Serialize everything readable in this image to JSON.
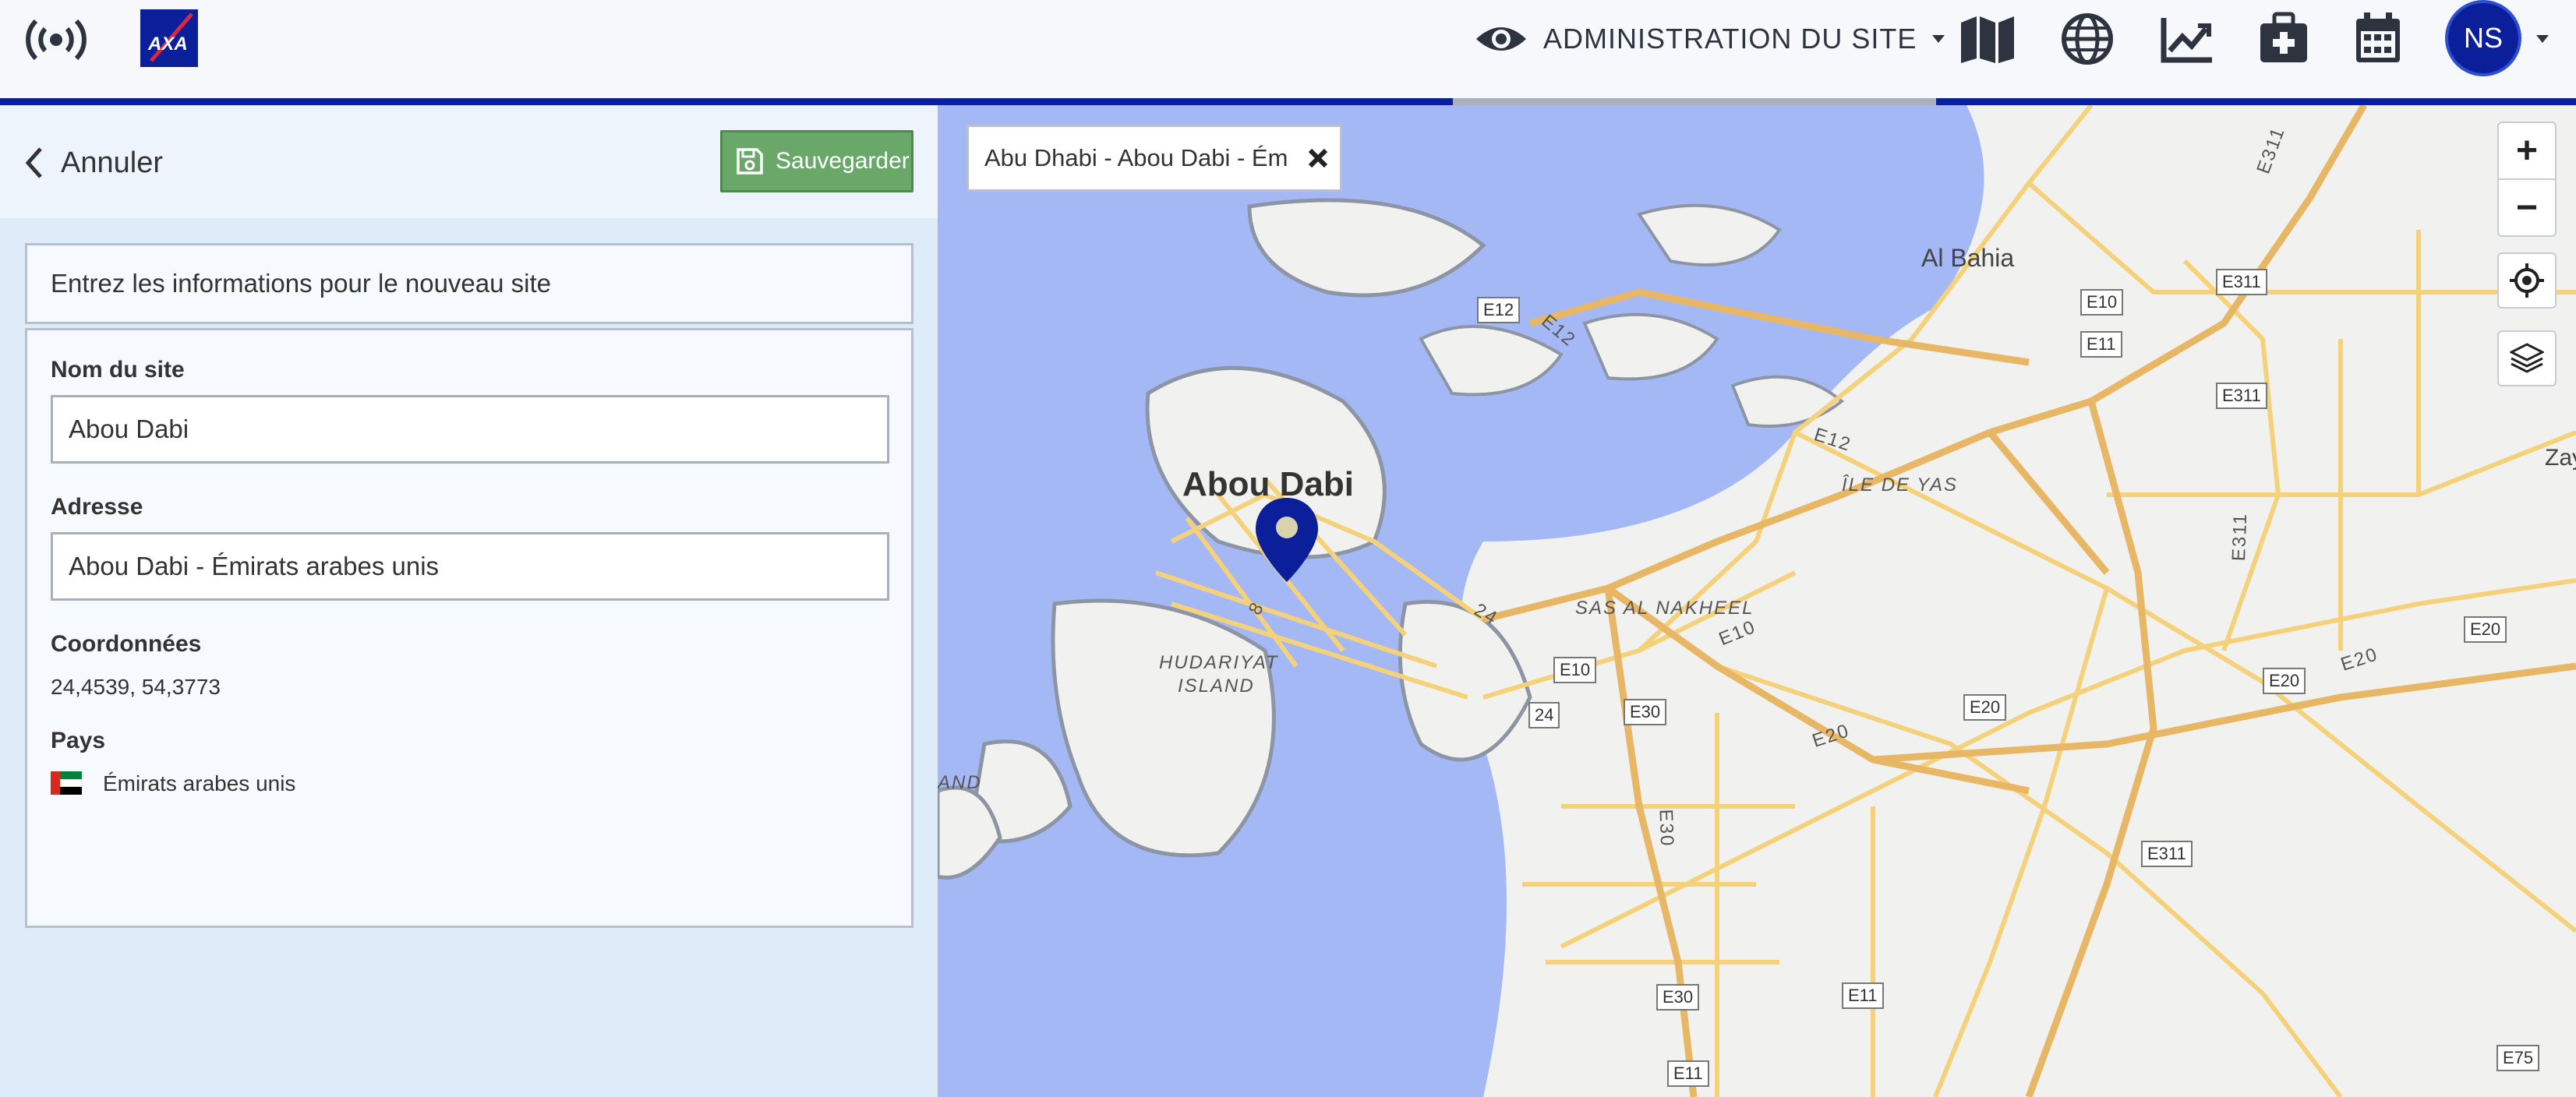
{
  "header": {
    "admin_label": "ADMINISTRATION DU SITE",
    "avatar_initials": "NS"
  },
  "panel": {
    "cancel_label": "Annuler",
    "save_label": "Sauvegarder",
    "info_text": "Entrez les informations pour le nouveau site",
    "site_name_label": "Nom du site",
    "site_name_value": "Abou Dabi",
    "address_label": "Adresse",
    "address_value": "Abou Dabi - Émirats arabes unis",
    "coords_label": "Coordonnées",
    "coords_value": "24,4539, 54,3773",
    "country_label": "Pays",
    "country_value": "Émirats arabes unis"
  },
  "map": {
    "search_chip": "Abu Dhabi - Abou Dabi - Ém",
    "city_label": "Abou Dabi",
    "place_labels": [
      "Al Bahia",
      "ÎLE DE YAS",
      "SAS AL NAKHEEL",
      "HUDARIYAT",
      "ISLAND",
      "AND",
      "Zay"
    ],
    "road_labels": [
      "E12",
      "E12",
      "E12",
      "E10",
      "E11",
      "E311",
      "E311",
      "E311",
      "E311",
      "E20",
      "E20",
      "E20",
      "E20",
      "E20",
      "E10",
      "E10",
      "E30",
      "E30",
      "E30",
      "24",
      "24",
      "E311",
      "E11",
      "E11",
      "E75",
      "8"
    ],
    "controls": [
      "+",
      "−"
    ]
  },
  "colors": {
    "brand_blue": "#0b1f9a",
    "water": "#a4b8f5",
    "save_green": "#6aa86a",
    "panel_bg": "#deebf8"
  }
}
